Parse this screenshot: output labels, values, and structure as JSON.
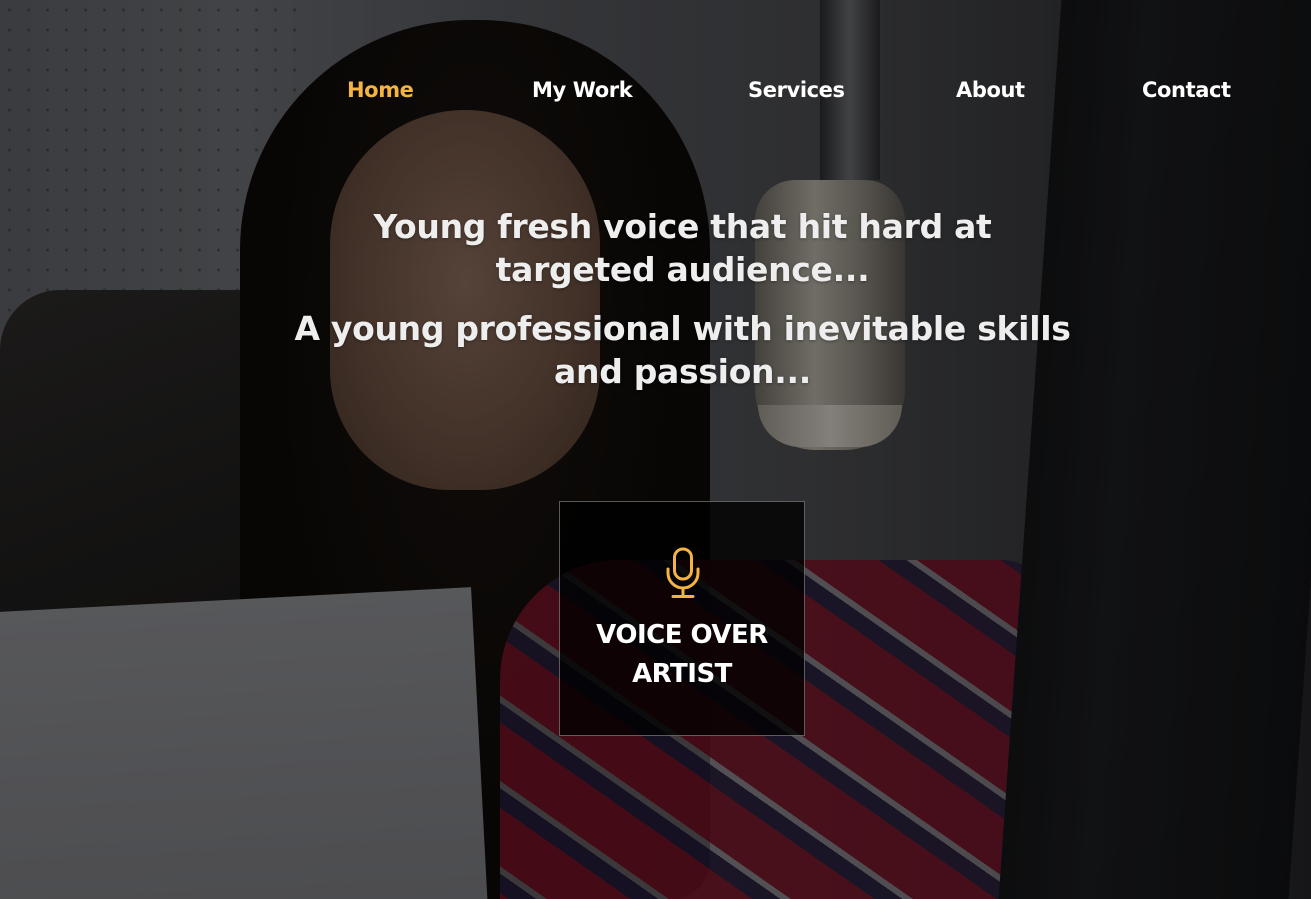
{
  "nav": {
    "items": [
      {
        "label": "Home",
        "active": true
      },
      {
        "label": "My Work",
        "active": false
      },
      {
        "label": "Services",
        "active": false
      },
      {
        "label": "About",
        "active": false
      },
      {
        "label": "Contact",
        "active": false
      }
    ],
    "active_color": "#f5b342",
    "text_color": "#ffffff"
  },
  "hero": {
    "tagline_1": "Young fresh voice that hit hard at targeted audience...",
    "tagline_2": "A young professional with inevitable skills and passion...",
    "background_image": "woman-with-headphones-at-studio-microphone"
  },
  "card": {
    "icon": "microphone-icon",
    "icon_color": "#f5b342",
    "title": "VOICE OVER\nARTIST"
  }
}
